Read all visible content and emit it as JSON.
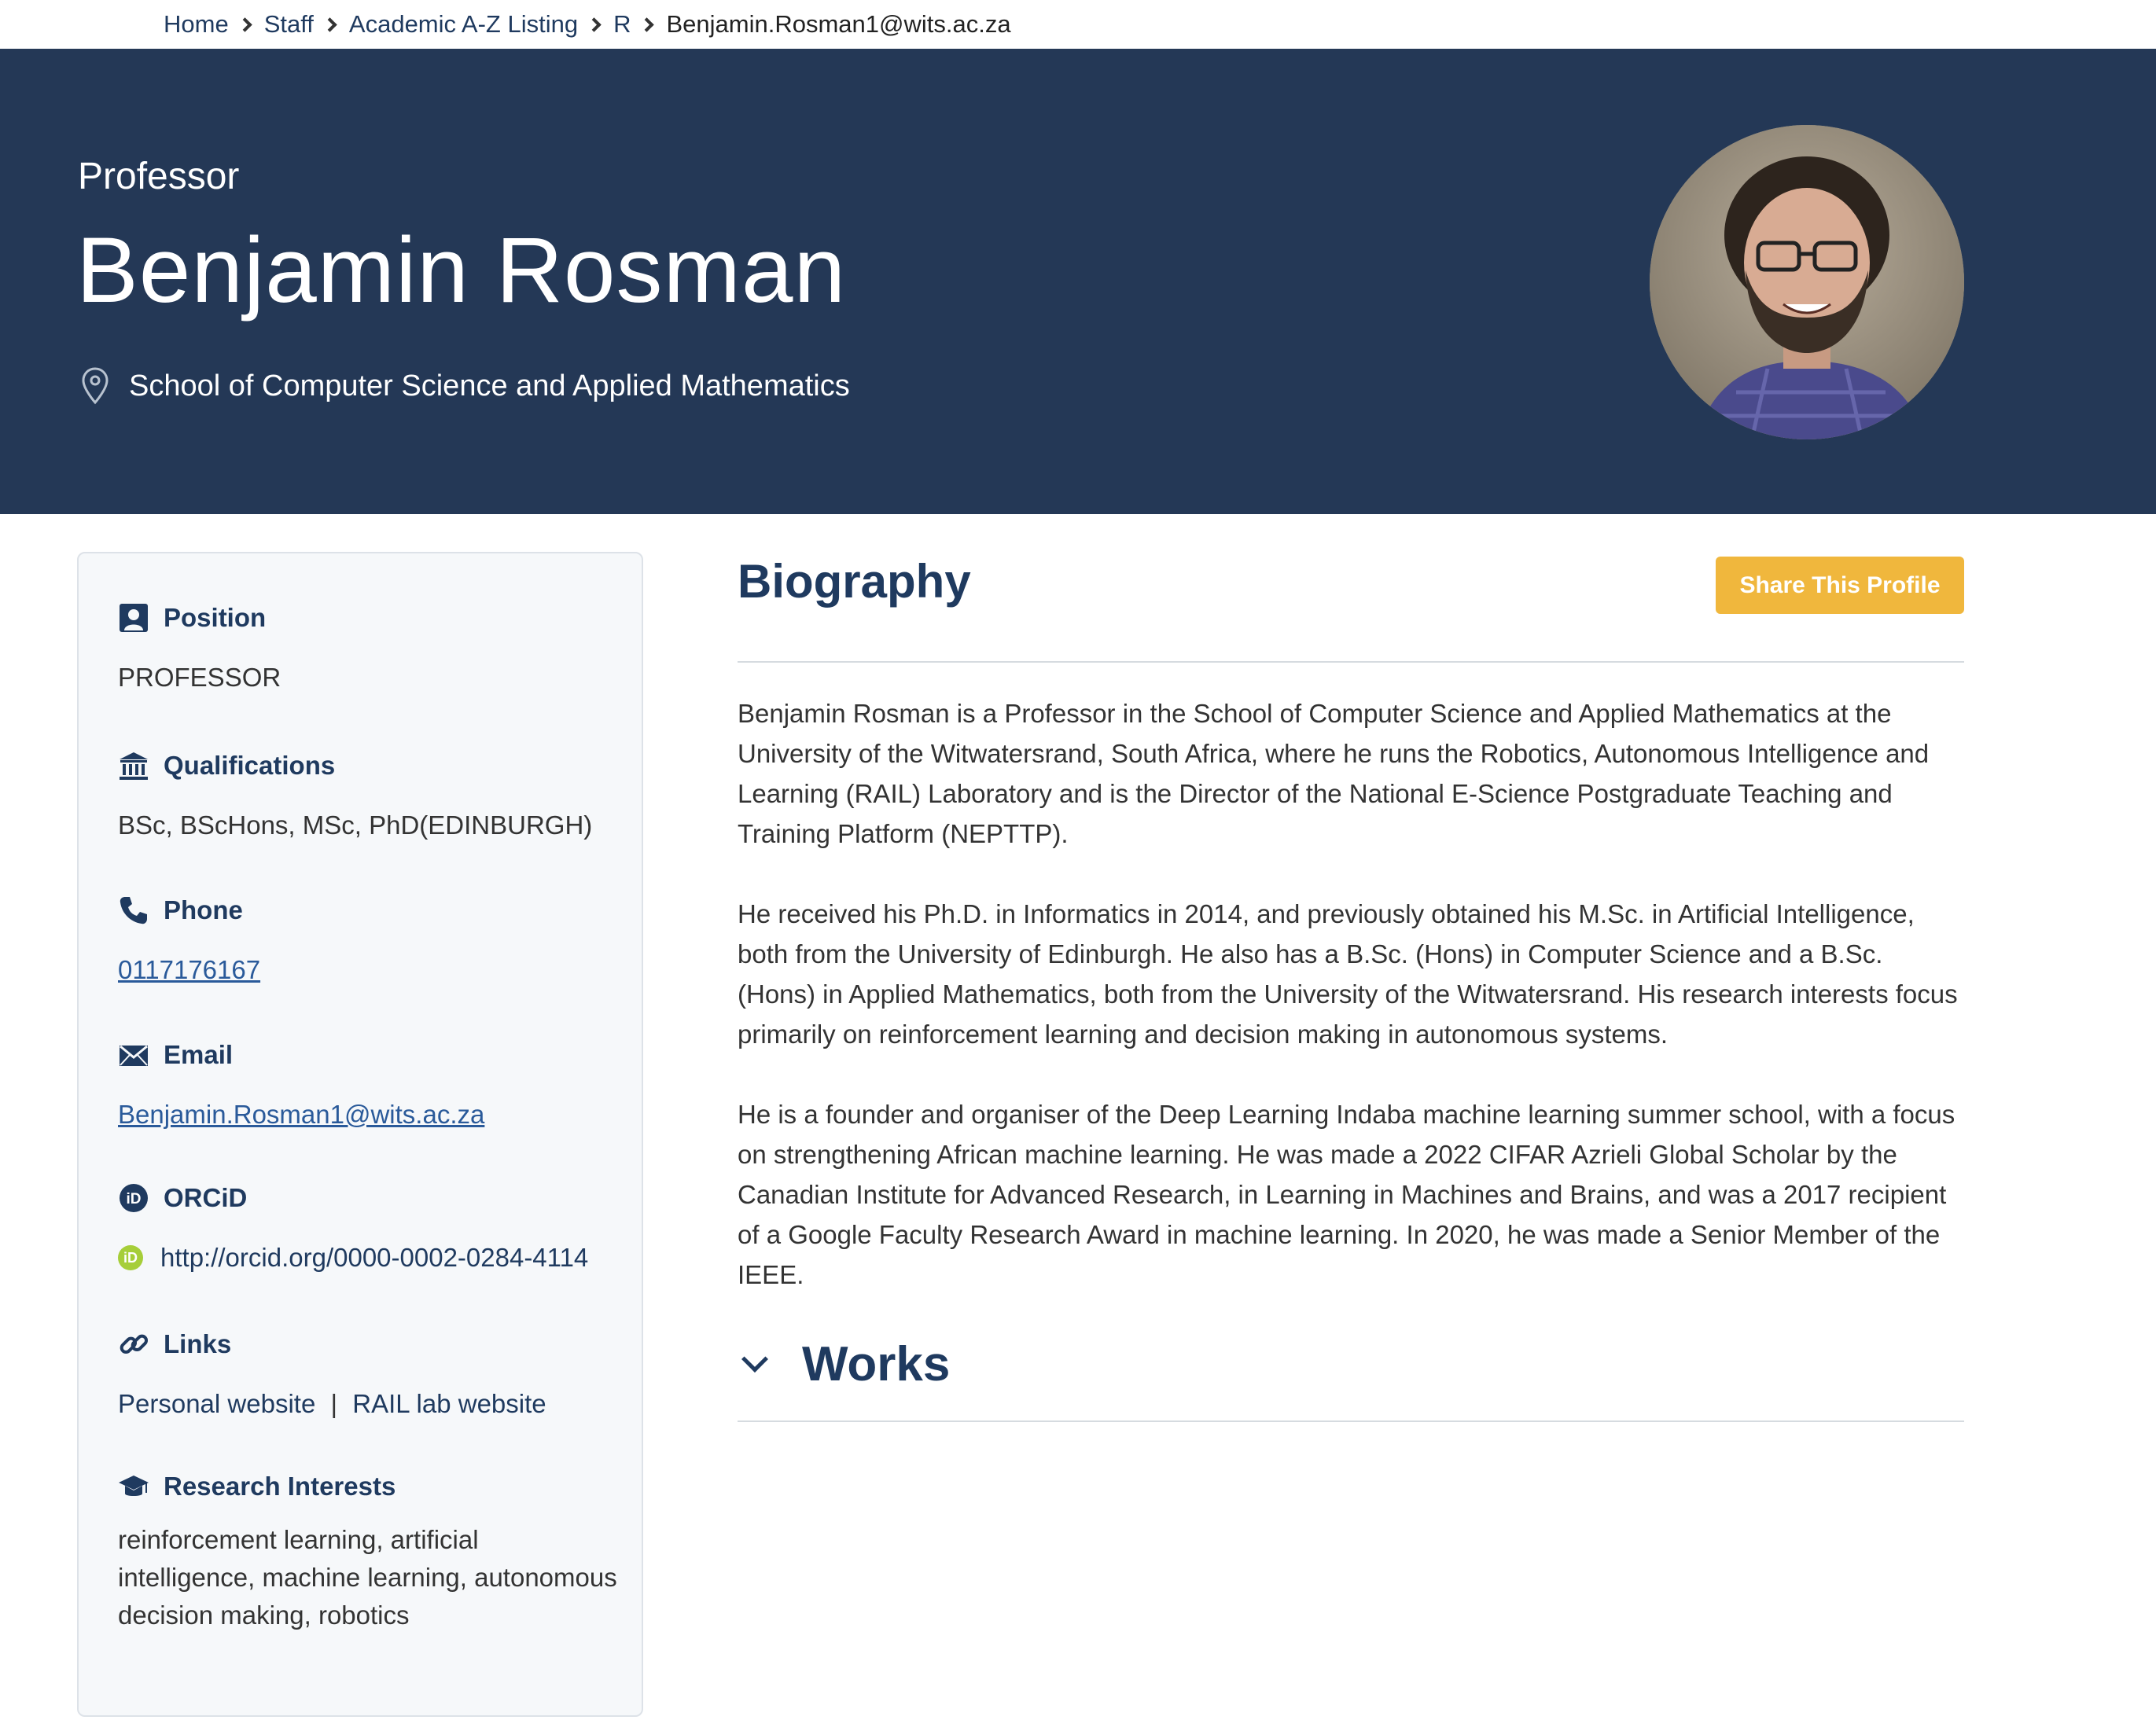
{
  "breadcrumb": {
    "items": [
      "Home",
      "Staff",
      "Academic A-Z Listing",
      "R"
    ],
    "current": "Benjamin.Rosman1@wits.ac.za"
  },
  "hero": {
    "role": "Professor",
    "name": "Benjamin Rosman",
    "school": "School of Computer Science and Applied Mathematics",
    "background_color": "#243856"
  },
  "sidebar": {
    "position": {
      "label": "Position",
      "value": "PROFESSOR"
    },
    "qualifications": {
      "label": "Qualifications",
      "value": "BSc, BScHons, MSc, PhD(EDINBURGH)"
    },
    "phone": {
      "label": "Phone",
      "value": "0117176167"
    },
    "email": {
      "label": "Email",
      "value": "Benjamin.Rosman1@wits.ac.za"
    },
    "orcid": {
      "label": "ORCiD",
      "badge": "iD",
      "value": "http://orcid.org/0000-0002-0284-4114"
    },
    "links": {
      "label": "Links",
      "personal": "Personal website",
      "separator": "|",
      "lab": "RAIL lab website"
    },
    "research": {
      "label": "Research Interests",
      "value": "reinforcement learning, artificial intelligence, machine learning, autonomous decision making, robotics"
    }
  },
  "main": {
    "biography_title": "Biography",
    "share_label": "Share This Profile",
    "share_color": "#f0b73d",
    "paragraphs": [
      "Benjamin Rosman is a Professor in the School of Computer Science and Applied Mathematics at the University of the Witwatersrand, South Africa, where he runs the Robotics, Autonomous Intelligence and Learning (RAIL) Laboratory and is the Director of the National E-Science Postgraduate Teaching and Training Platform (NEPTTP).",
      "He received his Ph.D. in Informatics in 2014, and previously obtained his M.Sc. in Artificial Intelligence, both from the University of Edinburgh. He also has a B.Sc. (Hons) in Computer Science and a B.Sc. (Hons) in Applied Mathematics, both from the University of the Witwatersrand. His research interests focus primarily on reinforcement learning and decision making in autonomous systems.",
      "He is a founder and organiser of the Deep Learning Indaba machine learning summer school, with a focus on strengthening African machine learning. He was made a 2022 CIFAR Azrieli Global Scholar by the Canadian Institute for Advanced Research, in Learning in Machines and Brains, and was a 2017 recipient of a Google Faculty Research Award in machine learning. In 2020, he was made a Senior Member of the IEEE."
    ],
    "works_title": "Works"
  },
  "icons": {
    "location": "location-pin-icon",
    "position": "person-badge-icon",
    "qualifications": "institution-icon",
    "phone": "phone-icon",
    "email": "envelope-icon",
    "orcid": "orcid-icon",
    "links": "link-icon",
    "research": "graduation-cap-icon",
    "works": "chevron-down-icon"
  }
}
